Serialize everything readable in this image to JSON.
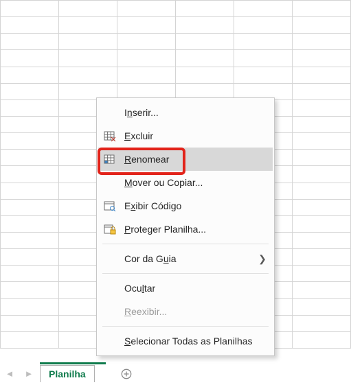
{
  "grid": {
    "rows": 21,
    "cols": 6
  },
  "sheet_tab": {
    "label": "Planilha"
  },
  "menu": {
    "items": [
      {
        "key": "insert",
        "label_pre": "I",
        "label_u": "n",
        "label_post": "serir...",
        "icon": "",
        "arrow": false,
        "disabled": false,
        "hover": false
      },
      {
        "key": "delete",
        "label_pre": "",
        "label_u": "E",
        "label_post": "xcluir",
        "icon": "delete-grid",
        "arrow": false,
        "disabled": false,
        "hover": false
      },
      {
        "key": "rename",
        "label_pre": "",
        "label_u": "R",
        "label_post": "enomear",
        "icon": "rename-grid",
        "arrow": false,
        "disabled": false,
        "hover": true
      },
      {
        "key": "move",
        "label_pre": "",
        "label_u": "M",
        "label_post": "over ou Copiar...",
        "icon": "",
        "arrow": false,
        "disabled": false,
        "hover": false
      },
      {
        "key": "code",
        "label_pre": "E",
        "label_u": "x",
        "label_post": "ibir Código",
        "icon": "code-sheet",
        "arrow": false,
        "disabled": false,
        "hover": false
      },
      {
        "key": "protect",
        "label_pre": "",
        "label_u": "P",
        "label_post": "roteger Planilha...",
        "icon": "lock-sheet",
        "arrow": false,
        "disabled": false,
        "hover": false
      },
      {
        "key": "tabcolor",
        "label_pre": "Cor da G",
        "label_u": "u",
        "label_post": "ia",
        "icon": "",
        "arrow": true,
        "disabled": false,
        "hover": false
      },
      {
        "key": "hide",
        "label_pre": "Ocu",
        "label_u": "l",
        "label_post": "tar",
        "icon": "",
        "arrow": false,
        "disabled": false,
        "hover": false
      },
      {
        "key": "unhide",
        "label_pre": "",
        "label_u": "R",
        "label_post": "eexibir...",
        "icon": "",
        "arrow": false,
        "disabled": true,
        "hover": false
      },
      {
        "key": "selall",
        "label_pre": "",
        "label_u": "S",
        "label_post": "elecionar Todas as Planilhas",
        "icon": "",
        "arrow": false,
        "disabled": false,
        "hover": false
      }
    ],
    "separators_after": [
      "protect",
      "tabcolor",
      "unhide"
    ]
  },
  "colors": {
    "accent_green": "#0f7b4c",
    "highlight_red": "#e2231a",
    "grid_border": "#d4d4d4",
    "menu_hover": "#d8d8d8"
  }
}
